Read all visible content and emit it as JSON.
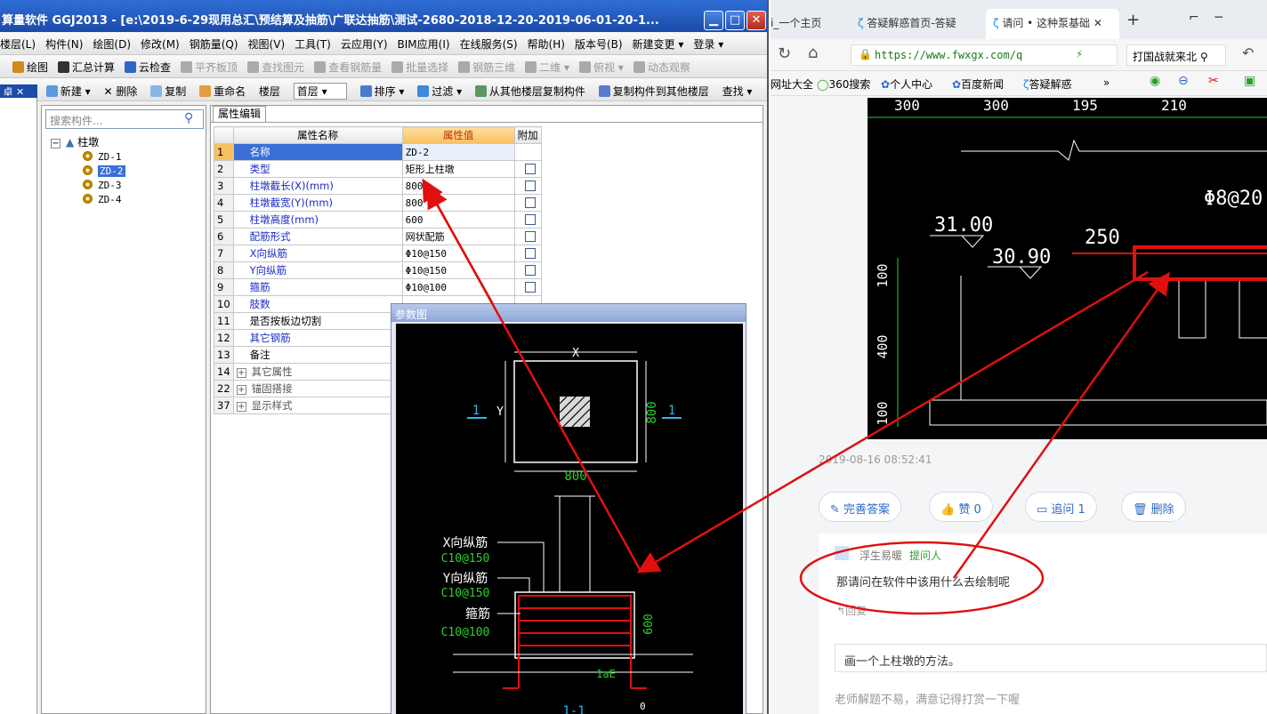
{
  "app": {
    "title": "算量软件 GGJ2013 - [e:\\2019-6-29现用总汇\\预结算及抽筋\\广联达抽筋\\测试-2680-2018-12-20-2019-06-01-20-1...",
    "menu": [
      "楼层(L)",
      "构件(N)",
      "绘图(D)",
      "修改(M)",
      "钢筋量(Q)",
      "视图(V)",
      "工具(T)",
      "云应用(Y)",
      "BIM应用(I)",
      "在线服务(S)",
      "帮助(H)",
      "版本号(B)",
      "新建变更 ▾",
      "登录 ▾"
    ],
    "toolbar1": [
      {
        "label": "绘图",
        "enabled": true
      },
      {
        "label": "汇总计算",
        "enabled": true
      },
      {
        "label": "云检查",
        "enabled": true
      },
      {
        "label": "平齐板顶",
        "enabled": false
      },
      {
        "label": "查找图元",
        "enabled": false
      },
      {
        "label": "查看钢筋量",
        "enabled": false
      },
      {
        "label": "批量选择",
        "enabled": false
      },
      {
        "label": "钢筋三维",
        "enabled": false
      },
      {
        "label": "二维 ▾",
        "enabled": false
      },
      {
        "label": "俯视 ▾",
        "enabled": false
      },
      {
        "label": "动态观察",
        "enabled": false
      }
    ],
    "toolbar2": {
      "new": "新建 ▾",
      "delete": "删除",
      "copy": "复制",
      "rename": "重命名",
      "floor_label": "楼层",
      "floor_value": "首层",
      "sort": "排序 ▾",
      "filter": "过滤 ▾",
      "copy_from": "从其他楼层复制构件",
      "copy_to": "复制构件到其他楼层",
      "find": "查找 ▾"
    },
    "search_placeholder": "搜索构件...",
    "tree": {
      "root": "柱墩",
      "items": [
        "ZD-1",
        "ZD-2",
        "ZD-3",
        "ZD-4"
      ],
      "selected": "ZD-2"
    },
    "prop_tab": "属性编辑",
    "prop_headers": {
      "name": "属性名称",
      "value": "属性值",
      "extra": "附加"
    },
    "props": [
      {
        "n": "1",
        "name": "名称",
        "value": "ZD-2",
        "blue": true,
        "cb": false
      },
      {
        "n": "2",
        "name": "类型",
        "value": "矩形上柱墩",
        "blue": true,
        "cb": true
      },
      {
        "n": "3",
        "name": "柱墩截长(X)(mm)",
        "value": "800",
        "blue": true,
        "cb": true
      },
      {
        "n": "4",
        "name": "柱墩截宽(Y)(mm)",
        "value": "800",
        "blue": true,
        "cb": true
      },
      {
        "n": "5",
        "name": "柱墩高度(mm)",
        "value": "600",
        "blue": true,
        "cb": true
      },
      {
        "n": "6",
        "name": "配筋形式",
        "value": "网状配筋",
        "blue": true,
        "cb": true
      },
      {
        "n": "7",
        "name": "X向纵筋",
        "value": "Φ10@150",
        "blue": true,
        "cb": true
      },
      {
        "n": "8",
        "name": "Y向纵筋",
        "value": "Φ10@150",
        "blue": true,
        "cb": true
      },
      {
        "n": "9",
        "name": "箍筋",
        "value": "Φ10@100",
        "blue": true,
        "cb": true
      },
      {
        "n": "10",
        "name": "肢数",
        "value": "",
        "blue": true,
        "cb": false
      },
      {
        "n": "11",
        "name": "是否按板边切割",
        "value": "",
        "blue": false,
        "cb": false
      },
      {
        "n": "12",
        "name": "其它钢筋",
        "value": "",
        "blue": true,
        "cb": false
      },
      {
        "n": "13",
        "name": "备注",
        "value": "",
        "blue": false,
        "cb": false
      },
      {
        "n": "14",
        "name": "其它属性",
        "value": "",
        "blue": false,
        "cb": false,
        "group": true
      },
      {
        "n": "22",
        "name": "锚固搭接",
        "value": "",
        "blue": false,
        "cb": false,
        "group": true
      },
      {
        "n": "37",
        "name": "显示样式",
        "value": "",
        "blue": false,
        "cb": false,
        "group": true
      }
    ],
    "param_title": "参数图",
    "cad": {
      "x": "X",
      "y": "Y",
      "sec": "1",
      "dimx": "800",
      "dimy": "800",
      "xbar": "X向纵筋",
      "xbar_val": "C10@150",
      "ybar": "Y向纵筋",
      "ybar_val": "C10@150",
      "stir": "箍筋",
      "stir_val": "C10@100",
      "h": "600",
      "lae": "1aE",
      "cut": "1-1",
      "zero": "0"
    }
  },
  "browser": {
    "tabs": [
      "i_一个主页",
      "答疑解惑首页-答疑",
      "请问 • 这种泵基础"
    ],
    "new_tab": "+",
    "url": "https://www.fwxgx.com/q",
    "search_text": "打国战就来北",
    "bookmarks": [
      "网址大全",
      "360搜索",
      "个人中心",
      "百度新闻",
      "答疑解惑"
    ],
    "drawing": {
      "d1": "300",
      "d2": "300",
      "d3": "195",
      "d4": "210",
      "lv1": "31.00",
      "lv2": "30.90",
      "len": "250",
      "bar": "Φ8@20",
      "h1": "100",
      "h2": "400",
      "h3": "100"
    },
    "timestamp": "2019-08-16 08:52:41",
    "actions": [
      {
        "label": "完善答案",
        "icon": "edit-icon"
      },
      {
        "label": "赞 0",
        "icon": "thumbs-up-icon"
      },
      {
        "label": "追问 1",
        "icon": "comment-icon"
      },
      {
        "label": "删除",
        "icon": "trash-icon"
      }
    ],
    "comment": {
      "user": "浮生易暖",
      "role": "提问人",
      "text": "那请问在软件中该用什么去绘制呢",
      "reply": "回复"
    },
    "answer": "画一个上柱墩的方法。",
    "footer": "老师解题不易，满意记得打赏一下喔"
  },
  "colors": {
    "title_bar": "#1c4ba8",
    "annotation_red": "#e01010",
    "link_blue": "#2b68c8",
    "selected_row": "#3a6fd8"
  }
}
